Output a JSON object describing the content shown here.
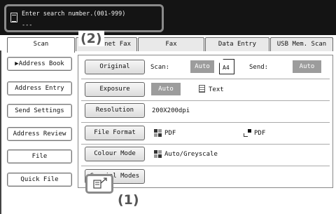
{
  "search": {
    "prompt": "Enter search number.(001-999)",
    "value": "---",
    "icon": "address-book-icon"
  },
  "callouts": {
    "one": "(1)",
    "two": "(2)"
  },
  "tabs": [
    {
      "label": "Scan",
      "active": true
    },
    {
      "label": "net Fax",
      "active": false
    },
    {
      "label": "Fax",
      "active": false
    },
    {
      "label": "Data Entry",
      "active": false
    },
    {
      "label": "USB Mem. Scan",
      "active": false
    }
  ],
  "sidebar": {
    "items": [
      {
        "label": "Address Book",
        "marker": "▶"
      },
      {
        "label": "Address Entry"
      },
      {
        "label": "Send Settings"
      },
      {
        "label": "Address Review"
      },
      {
        "label": "File"
      },
      {
        "label": "Quick File"
      }
    ]
  },
  "settings": {
    "original": {
      "button": "Original",
      "scan_label": "Scan:",
      "scan_value": "Auto",
      "paper": "A4",
      "send_label": "Send:",
      "send_value": "Auto"
    },
    "exposure": {
      "button": "Exposure",
      "value": "Auto",
      "mode": "Text"
    },
    "resolution": {
      "button": "Resolution",
      "value": "200X200dpi"
    },
    "file_format": {
      "button": "File Format",
      "format1": "PDF",
      "format2": "PDF"
    },
    "colour_mode": {
      "button": "Colour Mode",
      "value": "Auto/Greyscale"
    },
    "special_modes": {
      "button": "Special Modes"
    }
  },
  "bottom": {
    "icon": "job-status-icon"
  },
  "colors": {
    "dark_bar": "#141414",
    "callout_border": "#8a8a8a",
    "gray_value": "#9c9c9c"
  }
}
